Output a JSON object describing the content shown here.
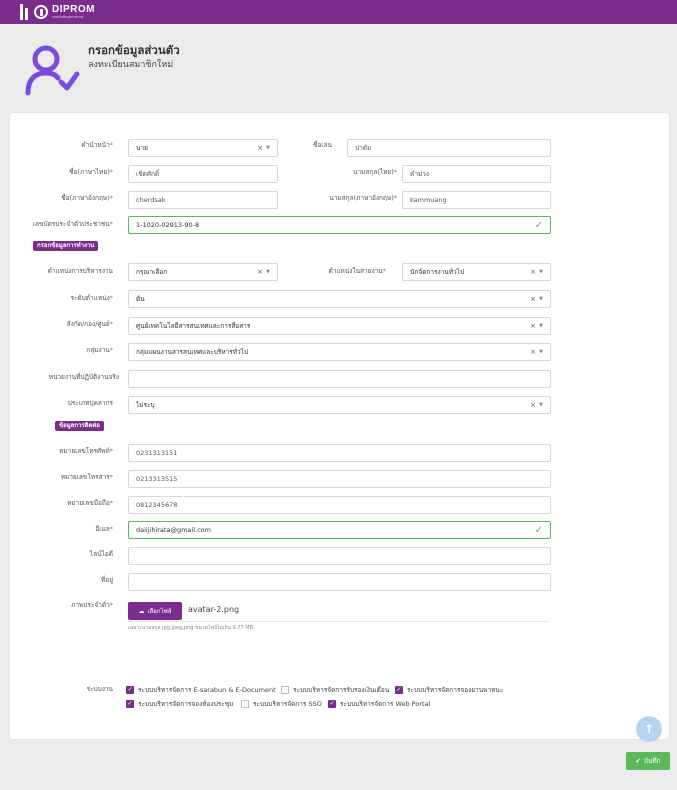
{
  "brand": {
    "name": "DIPROM",
    "tagline": "กรมส่งเสริมอุตสาหกรรม"
  },
  "header": {
    "title": "กรอกข้อมูลส่วนตัว",
    "subtitle": "ลงทะเบียนสมาชิกใหม่",
    "icon": "user-check-icon"
  },
  "colors": {
    "accent": "#7b2d8e",
    "success": "#5cb85c",
    "required": "#d9534f"
  },
  "personal": {
    "prefix": {
      "label": "คำนำหน้า",
      "value": "นาย"
    },
    "nickname": {
      "label": "ชื่อเล่น",
      "value": "ปาดัม"
    },
    "firstname_th": {
      "label": "ชื่อ(ภาษาไทย)",
      "value": "เชิดศักดิ์"
    },
    "lastname_th": {
      "label": "นามสกุล(ไทย)",
      "value": "คำม่วง"
    },
    "firstname_en": {
      "label": "ชื่อ(ภาษาอังกฤษ)",
      "value": "cherdsak"
    },
    "lastname_en": {
      "label": "นามสกุล(ภาษาอังกฤษ)",
      "value": "kammuang"
    },
    "citizen_id": {
      "label": "เลขบัตรประจำตัวประชาชน",
      "value": "1-1020-02913-90-8"
    }
  },
  "work": {
    "section": "กรอกข้อมูลการทำงาน",
    "admin_position": {
      "label": "ตำแหน่งการบริหารงาน",
      "value": "กรุณาเลือก"
    },
    "line_position": {
      "label": "ตำแหน่งในสายงาน",
      "value": "นักจัดการงานทั่วไป"
    },
    "level": {
      "label": "ระดับตำแหน่ง",
      "value": "ต้น"
    },
    "division": {
      "label": "สังกัด/กอง/ศูนย์",
      "value": "ศูนย์เทคโนโลยีสารสนเทศและการสื่อสาร"
    },
    "group": {
      "label": "กลุ่มงาน",
      "value": "กลุ่มแผนงานสารสนเทศและบริหารทั่วไป"
    },
    "actual_unit": {
      "label": "หน่วยงานที่ปฏิบัติงานจริง",
      "value": ""
    },
    "personnel_type": {
      "label": "ประเภทบุคลากร",
      "value": "ไม่ระบุ"
    }
  },
  "contact": {
    "section": "ข้อมูลการติดต่อ",
    "phone": {
      "label": "หมายเลขโทรศัพท์",
      "value": "0231313151"
    },
    "fax": {
      "label": "หมายเลขโทรสาร",
      "value": "0213313515"
    },
    "mobile": {
      "label": "หมายเลขมือถือ",
      "value": "0812345678"
    },
    "email": {
      "label": "อีเมล",
      "value": "daiijihirata@gmail.com"
    },
    "line_id": {
      "label": "ไลน์ไอดี",
      "value": ""
    },
    "address": {
      "label": "ที่อยู่",
      "value": ""
    }
  },
  "photo": {
    "label": "ภาพประจำตัว",
    "button": "เลือกไฟล์",
    "filename": "avatar-2.png",
    "hint": "เฉพาะนามสกุล jpg,jpeg,png ขนาดไฟล์ไม่เกิน 9.77 MB."
  },
  "systems": {
    "label": "ระบบงาน",
    "items": [
      {
        "label": "ระบบบริหารจัดการ E-sarabun & E-Document",
        "checked": true
      },
      {
        "label": "ระบบบริหารจัดการรับรองเงินเดือน",
        "checked": false
      },
      {
        "label": "ระบบบริหารจัดการจองยานพาหนะ",
        "checked": true
      },
      {
        "label": "ระบบบริหารจัดการจองห้องประชุม",
        "checked": true
      },
      {
        "label": "ระบบบริหารจัดการ SSO",
        "checked": false
      },
      {
        "label": "ระบบบริหารจัดการ Web Portal",
        "checked": true
      }
    ]
  },
  "actions": {
    "save": "บันทึก"
  }
}
